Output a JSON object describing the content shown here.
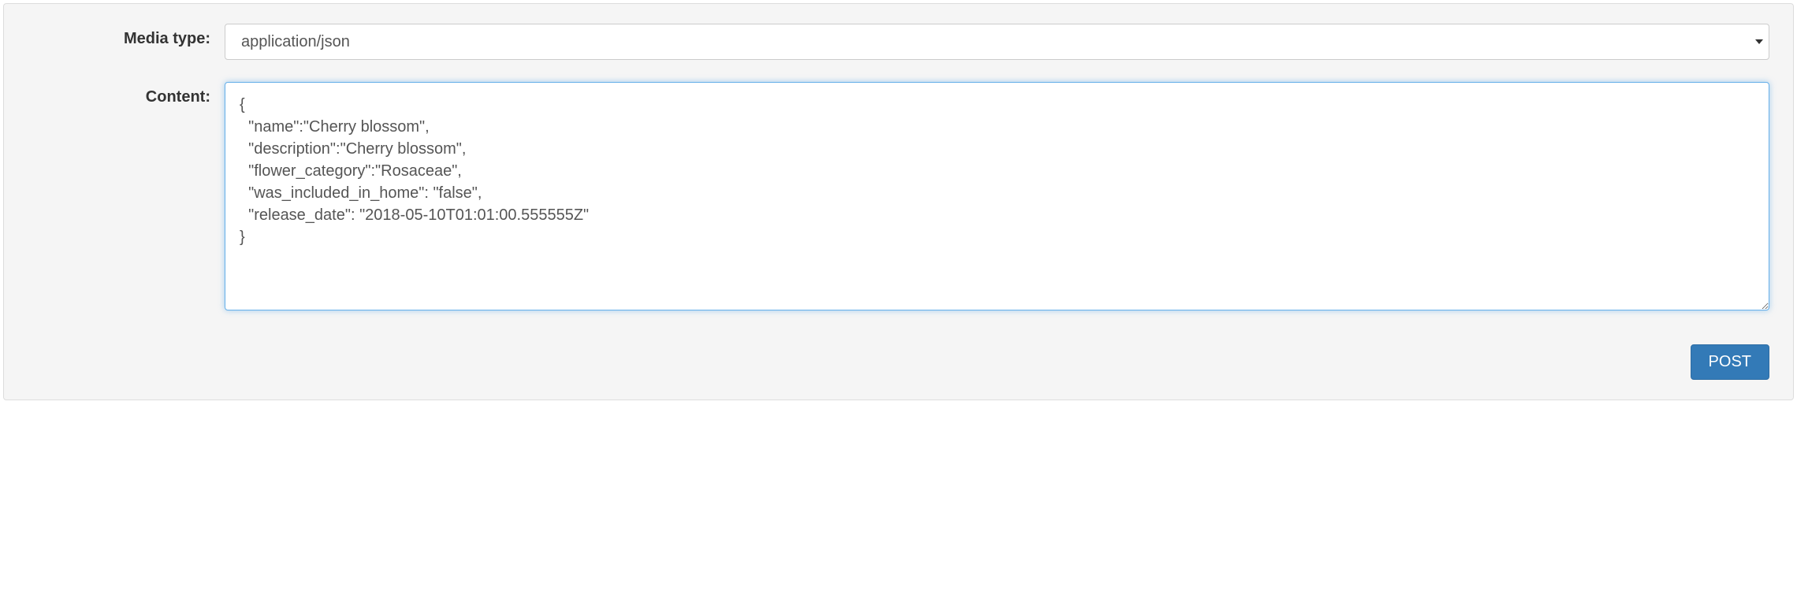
{
  "form": {
    "media_type_label": "Media type:",
    "media_type_value": "application/json",
    "content_label": "Content:",
    "content_value": "{\n  \"name\":\"Cherry blossom\",\n  \"description\":\"Cherry blossom\",\n  \"flower_category\":\"Rosaceae\",\n  \"was_included_in_home\": \"false\",\n  \"release_date\": \"2018-05-10T01:01:00.555555Z\"\n}",
    "post_button_label": "POST"
  }
}
